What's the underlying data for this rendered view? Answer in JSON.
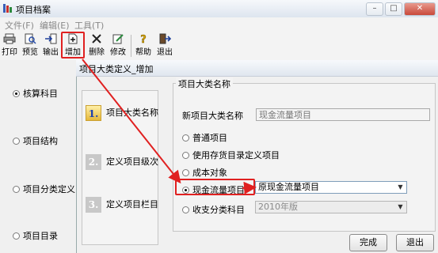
{
  "outer_window": {
    "title": "项目档案",
    "controls": [
      "–",
      "□",
      "✕"
    ]
  },
  "menu": [
    "文件(F)",
    "编辑(E)",
    "工具(T)"
  ],
  "toolbar": [
    {
      "label": "打印",
      "icon": "printer-icon"
    },
    {
      "label": "预览",
      "icon": "preview-icon"
    },
    {
      "label": "输出",
      "icon": "export-icon"
    },
    {
      "label": "增加",
      "icon": "add-document-icon"
    },
    {
      "label": "删除",
      "icon": "delete-icon"
    },
    {
      "label": "修改",
      "icon": "edit-icon"
    },
    {
      "label": "帮助",
      "icon": "help-icon"
    },
    {
      "label": "退出",
      "icon": "exit-icon"
    }
  ],
  "left_options": [
    {
      "label": "核算科目",
      "selected": true
    },
    {
      "label": "项目结构",
      "selected": false
    },
    {
      "label": "项目分类定义",
      "selected": false
    },
    {
      "label": "项目目录",
      "selected": false
    }
  ],
  "dialog": {
    "title": "项目大类定义_增加",
    "steps": [
      {
        "number": "1.",
        "label": "项目大类名称",
        "active": true
      },
      {
        "number": "2.",
        "label": "定义项目级次",
        "active": false
      },
      {
        "number": "3.",
        "label": "定义项目栏目",
        "active": false
      }
    ],
    "group_title": "项目大类名称",
    "name_label": "新项目大类名称",
    "name_value": "现金流量项目",
    "options": [
      {
        "label": "普通项目",
        "selected": false
      },
      {
        "label": "使用存货目录定义项目",
        "selected": false
      },
      {
        "label": "成本对象",
        "selected": false
      },
      {
        "label": "现金流量项目",
        "selected": true
      },
      {
        "label": "收支分类科目",
        "selected": false
      }
    ],
    "cash_flow_select": "原现金流量项目",
    "income_select": "2010年版",
    "buttons": {
      "finish": "完成",
      "exit": "退出"
    }
  },
  "colors": {
    "highlight": "#e02020"
  }
}
